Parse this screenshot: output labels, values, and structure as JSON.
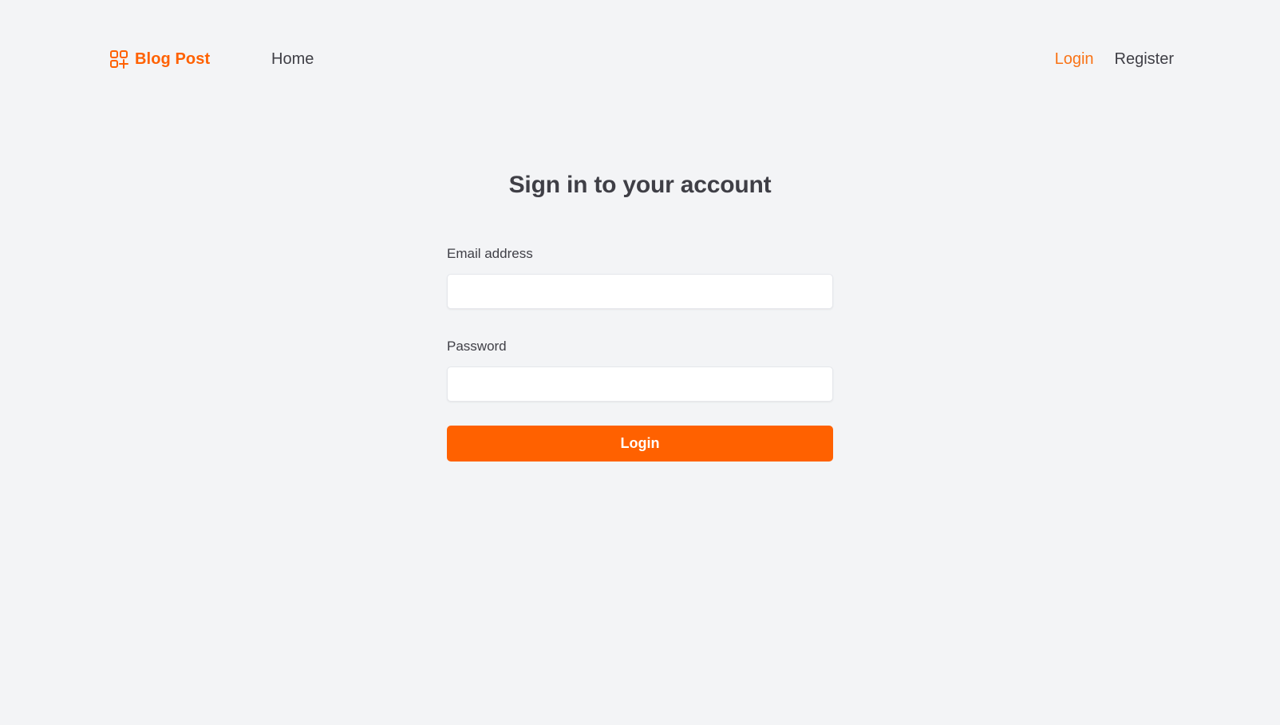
{
  "navbar": {
    "brand": {
      "name": "Blog Post",
      "icon": "apps-grid-plus-icon",
      "color": "#ff6100"
    },
    "left_links": [
      {
        "label": "Home"
      }
    ],
    "right_links": [
      {
        "label": "Login",
        "active": true
      },
      {
        "label": "Register",
        "active": false
      }
    ]
  },
  "page": {
    "title": "Sign in to your account"
  },
  "form": {
    "email": {
      "label": "Email address",
      "value": "",
      "placeholder": ""
    },
    "password": {
      "label": "Password",
      "value": "",
      "placeholder": ""
    },
    "submit_label": "Login"
  },
  "colors": {
    "accent": "#ff6100",
    "active_link": "#f97316",
    "text": "#3f3f46",
    "background": "#f3f4f6"
  }
}
